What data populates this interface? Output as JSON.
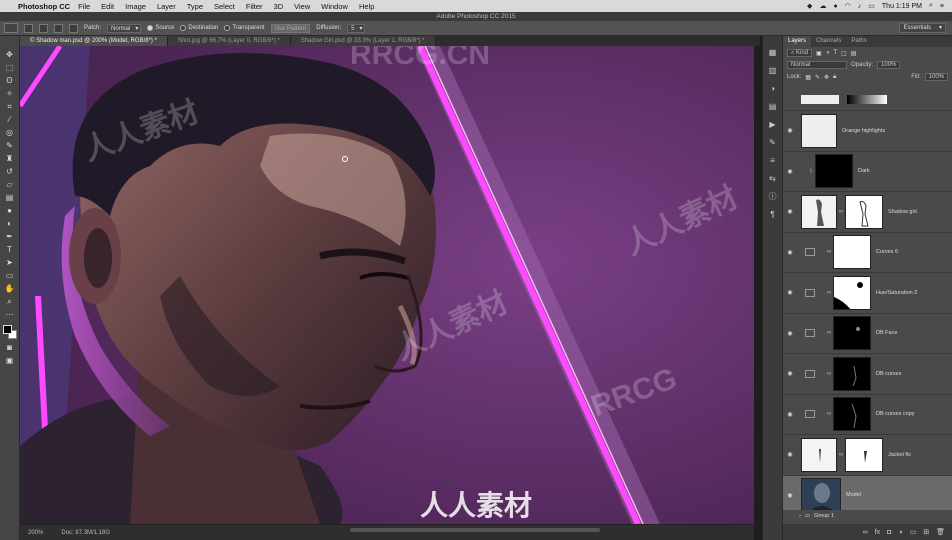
{
  "menubar": {
    "app_name": "Photoshop CC",
    "items": [
      "File",
      "Edit",
      "Image",
      "Layer",
      "Type",
      "Select",
      "Filter",
      "3D",
      "View",
      "Window",
      "Help"
    ],
    "clock": "Thu 1:19 PM"
  },
  "window": {
    "title": "Adobe Photoshop CC 2015"
  },
  "options": {
    "patch_label": "Patch:",
    "patch_mode": "Normal",
    "source_label": "Source",
    "destination_label": "Destination",
    "transparent_label": "Transparent",
    "use_pattern_label": "Use Pattern",
    "diffusion_label": "Diffusion:",
    "diffusion_value": "5",
    "workspace": "Essentials"
  },
  "tabs": [
    {
      "label": "© Shadow man.psd @ 200% (Model, RGB/8*) *",
      "active": true
    },
    {
      "label": "Shirt.jpg @ 66.7% (Layer 0, RGB/8*) *",
      "active": false
    },
    {
      "label": "Shadow Girl.psd @ 33.3% (Layer 1, RGB/8*) *",
      "active": false
    }
  ],
  "status": {
    "zoom": "200%",
    "doc": "Doc: 87.3M/1.18G"
  },
  "watermarks": {
    "en": "RRCG.CN",
    "cn": "人人素材",
    "en2": "RRCG"
  },
  "layers_panel": {
    "tabs": [
      "Layers",
      "Channels",
      "Paths"
    ],
    "kind_label": "Kind",
    "blend_mode": "Normal",
    "opacity_label": "Opacity:",
    "opacity_value": "100%",
    "lock_label": "Lock:",
    "fill_label": "Fill:",
    "fill_value": "100%",
    "layers": [
      {
        "name": "Orange highlights",
        "type": "pixel"
      },
      {
        "name": "Dark",
        "type": "mask-only"
      },
      {
        "name": "Shadow girl.",
        "type": "pixel-mask"
      },
      {
        "name": "Curves 6",
        "type": "adjustment"
      },
      {
        "name": "Hue/Saturation 2",
        "type": "adjustment"
      },
      {
        "name": "DB Face",
        "type": "adjustment"
      },
      {
        "name": "DB curves",
        "type": "adjustment"
      },
      {
        "name": "DB curves copy",
        "type": "adjustment"
      },
      {
        "name": "Jacket fix",
        "type": "pixel-mask"
      },
      {
        "name": "Model",
        "type": "image",
        "selected": true
      }
    ],
    "group_name": "Group 1"
  },
  "colors": {
    "canvas_bg": "#5a2d63",
    "neon": "#ff4bff",
    "panel": "#4a4a4a"
  }
}
